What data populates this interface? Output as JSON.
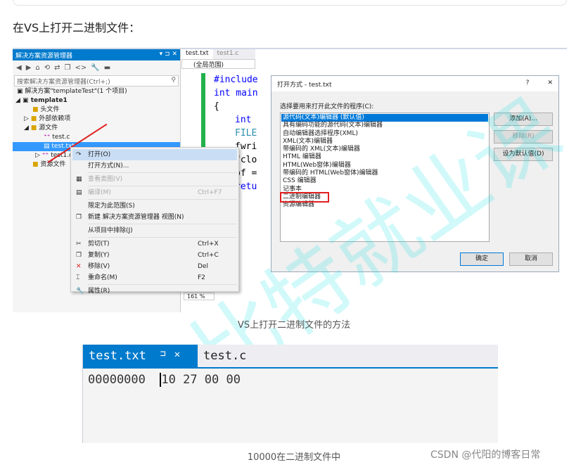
{
  "heading": "在VS上打开二进制文件：",
  "figure1": {
    "caption": "VS上打开二进制文件的方法",
    "solution_explorer": {
      "title": "解决方案资源管理器",
      "search_placeholder": "搜索解决方案资源管理器(Ctrl+;)",
      "tree": [
        "解决方案\"templateTest\"(1 个项目)",
        "template1",
        "头文件",
        "外部依赖项",
        "源文件",
        "test.c",
        "test.txt",
        "test1.c",
        "资源文件"
      ]
    },
    "editor": {
      "tabs": [
        "test.txt",
        "test1.c"
      ],
      "scope": "(全局范围)",
      "code": [
        "#include",
        "int main",
        "{",
        "int",
        "FILE",
        "fwri",
        "fclo",
        "pf =",
        "retu"
      ],
      "zoom": "161 %"
    },
    "context_menu": [
      {
        "label": "打开(O)",
        "icon": "redo-icon",
        "shortcut": "",
        "state": "highlighted"
      },
      {
        "label": "打开方式(N)...",
        "icon": "",
        "shortcut": "",
        "state": "normal"
      },
      {
        "label": "查看类图(V)",
        "icon": "class-diagram-icon",
        "shortcut": "",
        "state": "disabled"
      },
      {
        "label": "编译(M)",
        "icon": "compile-icon",
        "shortcut": "Ctrl+F7",
        "state": "disabled"
      },
      {
        "label": "限定为此范围(S)",
        "icon": "",
        "shortcut": "",
        "state": "normal"
      },
      {
        "label": "新建 解决方案资源管理器 视图(N)",
        "icon": "new-view-icon",
        "shortcut": "",
        "state": "normal"
      },
      {
        "label": "从项目中排除(J)",
        "icon": "",
        "shortcut": "",
        "state": "normal"
      },
      {
        "label": "剪切(T)",
        "icon": "scissors-icon",
        "shortcut": "Ctrl+X",
        "state": "normal"
      },
      {
        "label": "复制(Y)",
        "icon": "copy-icon",
        "shortcut": "Ctrl+C",
        "state": "normal"
      },
      {
        "label": "移除(V)",
        "icon": "delete-x-icon",
        "shortcut": "Del",
        "state": "normal"
      },
      {
        "label": "重命名(M)",
        "icon": "rename-icon",
        "shortcut": "F2",
        "state": "normal"
      },
      {
        "label": "属性(R)",
        "icon": "wrench-icon",
        "shortcut": "",
        "state": "normal"
      }
    ],
    "dialog": {
      "title": "打开方式 - test.txt",
      "help": "?",
      "close": "✕",
      "label": "选择要用来打开此文件的程序(C):",
      "programs": [
        "源代码(文本)编辑器 (默认值)",
        "具有编码功能的源代码(文本)编辑器",
        "自动编辑器选择程序(XML)",
        "XML(文本)编辑器",
        "带编码的 XML(文本)编辑器",
        "HTML 编辑器",
        "HTML(Web窗体)编辑器",
        "带编码的 HTML(Web窗体)编辑器",
        "CSS 编辑器",
        "记事本",
        "二进制编辑器",
        "资源编辑器"
      ],
      "selected": "源代码(文本)编辑器 (默认值)",
      "highlighted": "二进制编辑器",
      "add": "添加(A)...",
      "remove": "移除(R)",
      "set_default": "设为默认值(D)",
      "ok": "确定",
      "cancel": "取消"
    },
    "watermark": "比特就业课"
  },
  "figure2": {
    "caption": "10000在二进制文件中",
    "tabs": [
      "test.txt",
      "test.c"
    ],
    "pin": "⊐",
    "close": "✕",
    "address": "00000000",
    "bytes": "10 27 00 00"
  },
  "footer": "CSDN @代阳的博客日常",
  "colors": {
    "vs_blue": "#007acc",
    "highlight_red": "#e02020"
  }
}
